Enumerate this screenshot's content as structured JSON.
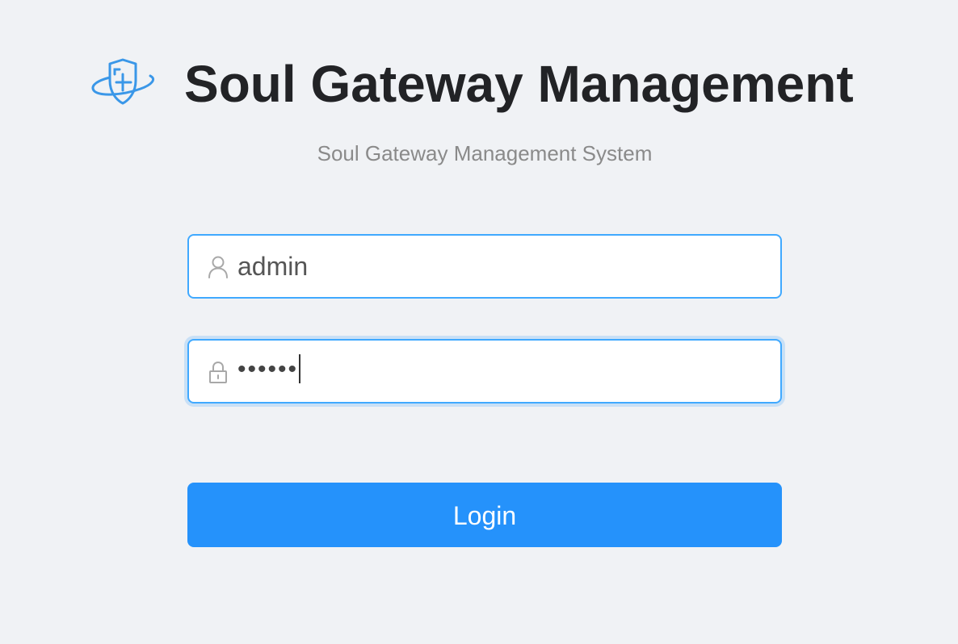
{
  "header": {
    "title": "Soul Gateway Management",
    "subtitle": "Soul Gateway Management System",
    "logo_icon": "shield-logo-icon"
  },
  "form": {
    "username": {
      "value": "admin",
      "icon": "user-icon"
    },
    "password": {
      "value": "••••••",
      "icon": "lock-icon"
    },
    "login_label": "Login"
  },
  "colors": {
    "background": "#f0f2f5",
    "accent": "#2592fb",
    "input_border": "#40a9ff",
    "title": "#222326",
    "subtitle": "#8a8a8a"
  }
}
